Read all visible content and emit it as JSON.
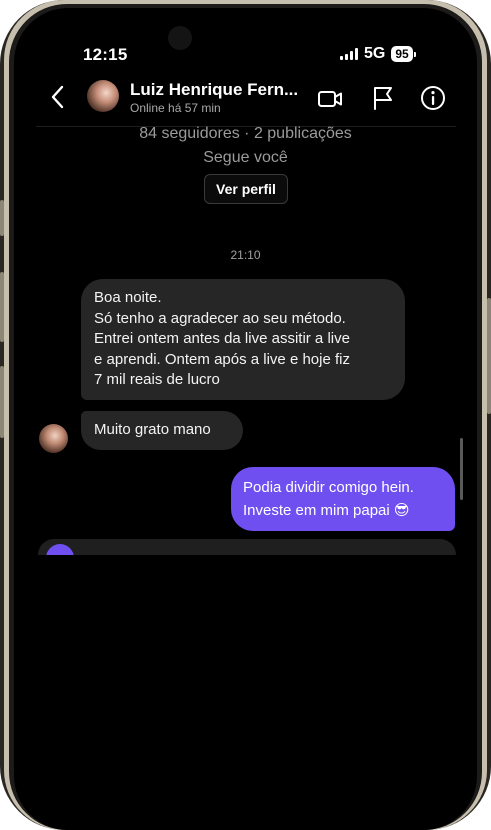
{
  "status": {
    "time": "12:15",
    "network": "5G",
    "battery": "95"
  },
  "header": {
    "name": "Luiz Henrique Fern...",
    "presence": "Online há 57 min",
    "icons": [
      "chevron-left-icon",
      "video-camera-icon",
      "flag-icon",
      "info-icon"
    ]
  },
  "profile": {
    "stats": "84 seguidores · 2 publicações",
    "follows": "Segue você",
    "view_profile_label": "Ver perfil"
  },
  "thread": {
    "timestamp": "21:10",
    "messages": [
      {
        "from": "contact",
        "lines": [
          "Boa noite.",
          "Só tenho a agradecer ao seu método.",
          "Entrei ontem antes da live assitir a live",
          "e aprendi. Ontem após a live e hoje fiz",
          "7 mil reais de lucro"
        ]
      },
      {
        "from": "contact",
        "text": "Muito grato mano"
      },
      {
        "from": "me",
        "lines": [
          "Podia dividir comigo hein.",
          "Investe em mim papai 😎"
        ]
      }
    ]
  },
  "colors": {
    "outgoing_bubble": "#6f4ff0",
    "incoming_bubble": "#262626",
    "background": "#000000"
  }
}
